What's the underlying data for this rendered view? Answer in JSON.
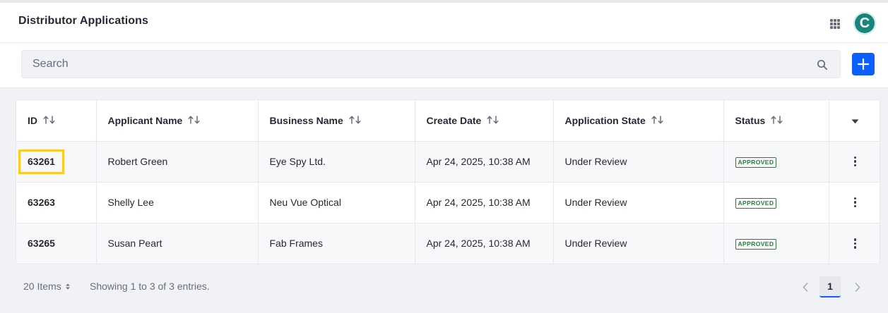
{
  "header": {
    "title": "Distributor Applications",
    "avatar_letter": "C",
    "apps_icon": "grid-icon"
  },
  "search": {
    "placeholder": "Search",
    "value": ""
  },
  "table": {
    "columns": [
      "ID",
      "Applicant Name",
      "Business Name",
      "Create Date",
      "Application State",
      "Status"
    ],
    "rows": [
      {
        "id": "63261",
        "applicant": "Robert Green",
        "business": "Eye Spy Ltd.",
        "date": "Apr 24, 2025, 10:38 AM",
        "state": "Under Review",
        "status": "APPROVED"
      },
      {
        "id": "63263",
        "applicant": "Shelly Lee",
        "business": "Neu Vue Optical",
        "date": "Apr 24, 2025, 10:38 AM",
        "state": "Under Review",
        "status": "APPROVED"
      },
      {
        "id": "63265",
        "applicant": "Susan Peart",
        "business": "Fab Frames",
        "date": "Apr 24, 2025, 10:38 AM",
        "state": "Under Review",
        "status": "APPROVED"
      }
    ]
  },
  "footer": {
    "items_per_page": "20 Items",
    "showing": "Showing 1 to 3 of 3 entries.",
    "current_page": "1"
  },
  "colors": {
    "primary": "#0b5fff",
    "avatar": "#16867d",
    "approved": "#287d3c",
    "highlight": "#ffc926"
  }
}
